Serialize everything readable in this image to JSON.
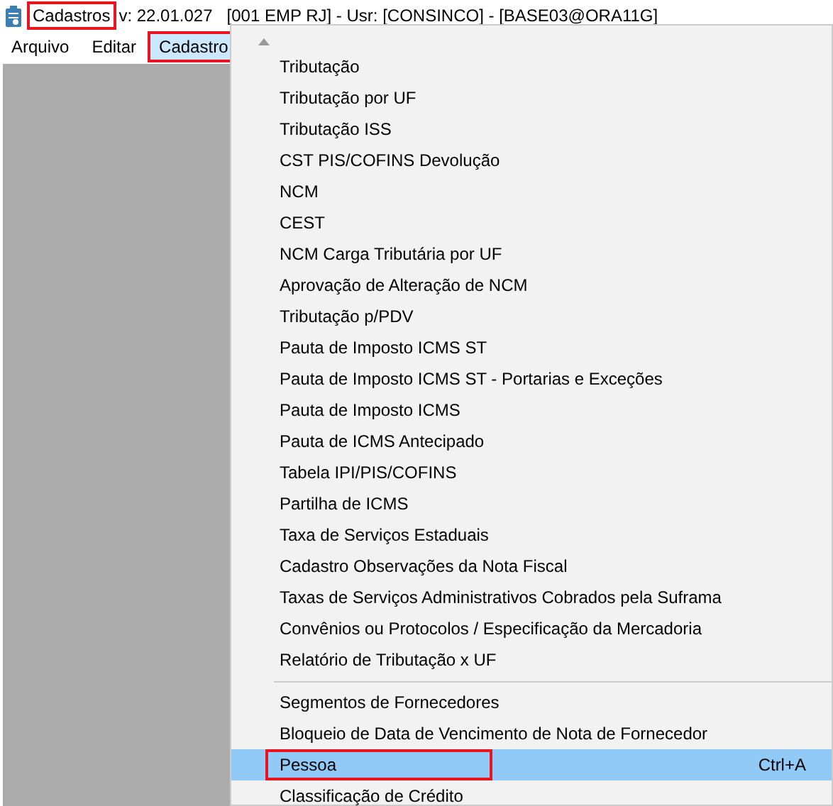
{
  "title_bar": {
    "app_name": "Cadastros",
    "app_name_highlighted": true,
    "info": "v: 22.01.027   [001 EMP RJ] - Usr: [CONSINCO] - [BASE03@ORA11G]"
  },
  "menu_bar": [
    {
      "label": "Arquivo",
      "selected": false,
      "highlighted": false
    },
    {
      "label": "Editar",
      "selected": false,
      "highlighted": false
    },
    {
      "label": "Cadastro",
      "selected": true,
      "highlighted": true
    }
  ],
  "dropdown": [
    {
      "kind": "item",
      "label": "Tributação",
      "selected": false,
      "highlighted": false
    },
    {
      "kind": "item",
      "label": "Tributação por UF",
      "selected": false,
      "highlighted": false
    },
    {
      "kind": "item",
      "label": "Tributação ISS",
      "selected": false,
      "highlighted": false
    },
    {
      "kind": "item",
      "label": "CST PIS/COFINS Devolução",
      "selected": false,
      "highlighted": false
    },
    {
      "kind": "item",
      "label": "NCM",
      "selected": false,
      "highlighted": false
    },
    {
      "kind": "item",
      "label": "CEST",
      "selected": false,
      "highlighted": false
    },
    {
      "kind": "item",
      "label": "NCM Carga Tributária por UF",
      "selected": false,
      "highlighted": false
    },
    {
      "kind": "item",
      "label": "Aprovação de Alteração de NCM",
      "selected": false,
      "highlighted": false
    },
    {
      "kind": "item",
      "label": "Tributação p/PDV",
      "selected": false,
      "highlighted": false
    },
    {
      "kind": "item",
      "label": "Pauta de Imposto ICMS ST",
      "selected": false,
      "highlighted": false
    },
    {
      "kind": "item",
      "label": "Pauta de Imposto ICMS ST - Portarias e Exceções",
      "selected": false,
      "highlighted": false
    },
    {
      "kind": "item",
      "label": "Pauta de Imposto ICMS",
      "selected": false,
      "highlighted": false
    },
    {
      "kind": "item",
      "label": "Pauta de ICMS Antecipado",
      "selected": false,
      "highlighted": false
    },
    {
      "kind": "item",
      "label": "Tabela IPI/PIS/COFINS",
      "selected": false,
      "highlighted": false
    },
    {
      "kind": "item",
      "label": "Partilha de ICMS",
      "selected": false,
      "highlighted": false
    },
    {
      "kind": "item",
      "label": "Taxa de Serviços Estaduais",
      "selected": false,
      "highlighted": false
    },
    {
      "kind": "item",
      "label": "Cadastro Observações da Nota Fiscal",
      "selected": false,
      "highlighted": false
    },
    {
      "kind": "item",
      "label": "Taxas de Serviços Administrativos Cobrados pela Suframa",
      "selected": false,
      "highlighted": false
    },
    {
      "kind": "item",
      "label": "Convênios ou Protocolos / Especificação da Mercadoria",
      "selected": false,
      "highlighted": false
    },
    {
      "kind": "item",
      "label": "Relatório de Tributação x UF",
      "selected": false,
      "highlighted": false
    },
    {
      "kind": "separator"
    },
    {
      "kind": "item",
      "label": "Segmentos de Fornecedores",
      "selected": false,
      "highlighted": false
    },
    {
      "kind": "item",
      "label": "Bloqueio de Data de Vencimento de Nota de Fornecedor",
      "selected": false,
      "highlighted": false
    },
    {
      "kind": "item",
      "label": "Pessoa",
      "shortcut": "Ctrl+A",
      "selected": true,
      "highlighted": true
    },
    {
      "kind": "item",
      "label": "Classificação de Crédito",
      "selected": false,
      "highlighted": false
    }
  ]
}
